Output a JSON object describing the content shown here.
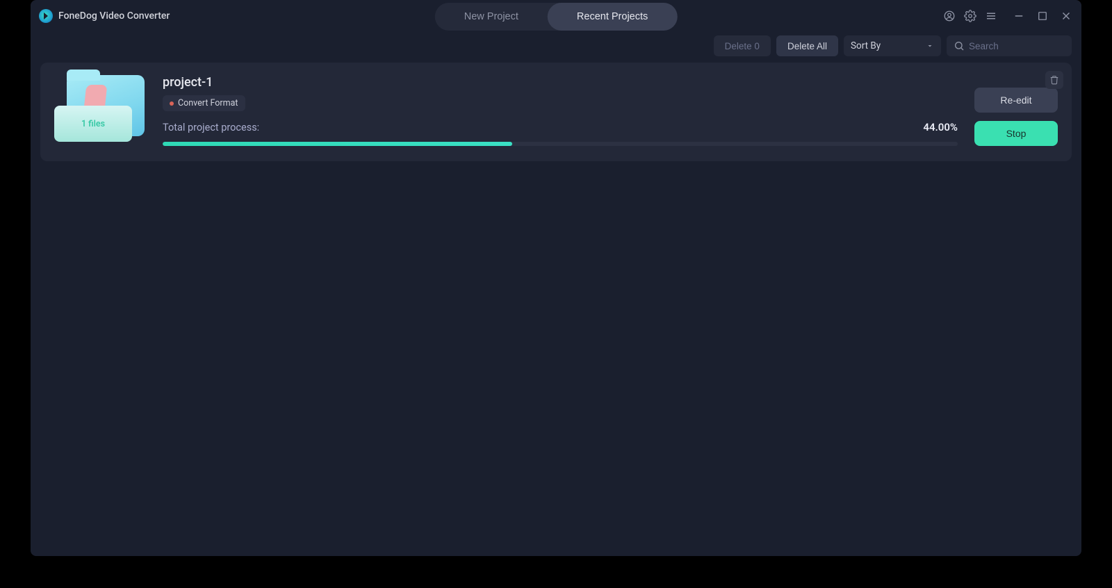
{
  "app": {
    "title": "FoneDog Video Converter"
  },
  "tabs": {
    "new_project": "New Project",
    "recent_projects": "Recent Projects"
  },
  "toolbar": {
    "delete_count_label": "Delete 0",
    "delete_all_label": "Delete All",
    "sort_by_label": "Sort By",
    "search_placeholder": "Search"
  },
  "project": {
    "name": "project-1",
    "files_label": "1 files",
    "tag": "Convert Format",
    "progress_label": "Total project process:",
    "percent_text": "44.00%",
    "percent_value": 44,
    "reedit_label": "Re-edit",
    "stop_label": "Stop"
  }
}
